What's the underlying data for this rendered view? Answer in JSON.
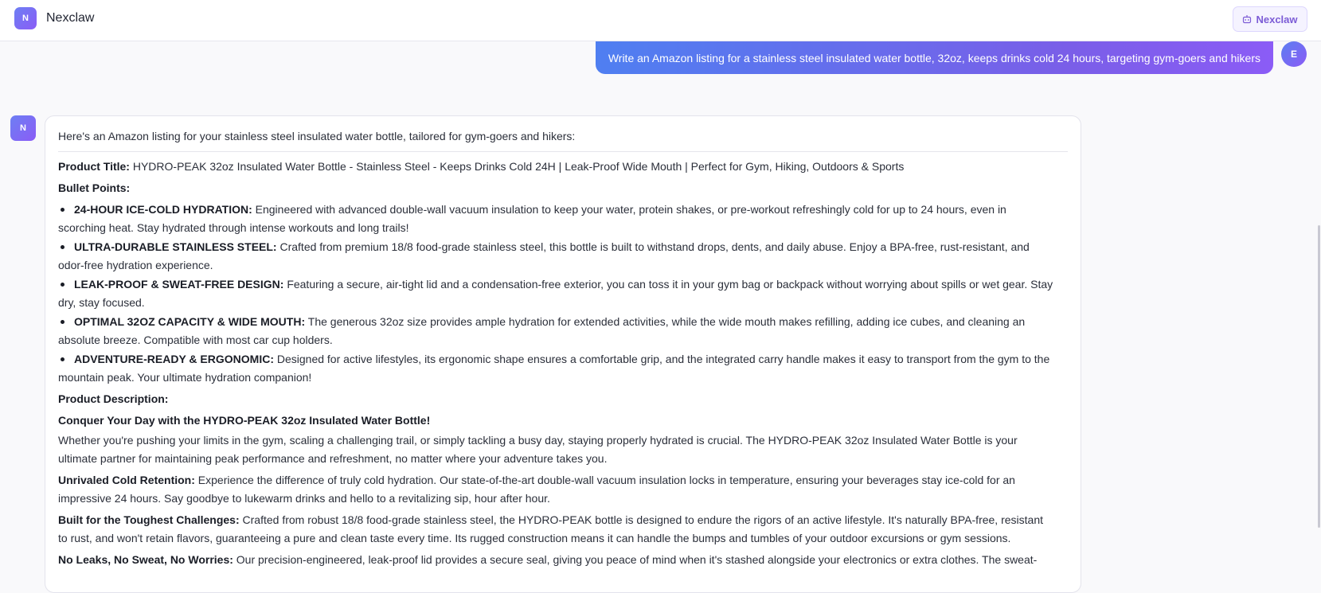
{
  "app": {
    "logo_letter": "N",
    "title": "Nexclaw",
    "header_button_label": "Nexclaw",
    "brand_colors": [
      "#6d7ff3",
      "#8b5cf6"
    ]
  },
  "user_message": {
    "avatar_letter": "E",
    "text": "Write an Amazon listing for a stainless steel insulated water bottle, 32oz, keeps drinks cold 24 hours, targeting gym-goers and hikers"
  },
  "assistant_message": {
    "avatar_letter": "N",
    "intro": "Here's an Amazon listing for your stainless steel insulated water bottle, tailored for gym-goers and hikers:",
    "title_label": "Product Title:",
    "title_text": "HYDRO-PEAK 32oz Insulated Water Bottle - Stainless Steel - Keeps Drinks Cold 24H | Leak-Proof Wide Mouth | Perfect for Gym, Hiking, Outdoors & Sports",
    "bullets_label": "Bullet Points:",
    "bullets": [
      {
        "label": "24-HOUR ICE-COLD HYDRATION:",
        "line1": "Engineered with advanced double-wall vacuum insulation to keep your water, protein shakes, or pre-workout refreshingly cold for up to 24 hours, even in",
        "line2": "scorching heat. Stay hydrated through intense workouts and long trails!"
      },
      {
        "label": "ULTRA-DURABLE STAINLESS STEEL:",
        "line1": "Crafted from premium 18/8 food-grade stainless steel, this bottle is built to withstand drops, dents, and daily abuse. Enjoy a BPA-free, rust-resistant, and",
        "line2": "odor-free hydration experience."
      },
      {
        "label": "LEAK-PROOF & SWEAT-FREE DESIGN:",
        "line1": "Featuring a secure, air-tight lid and a condensation-free exterior, you can toss it in your gym bag or backpack without worrying about spills or wet gear. Stay",
        "line2": "dry, stay focused."
      },
      {
        "label": "OPTIMAL 32OZ CAPACITY & WIDE MOUTH:",
        "line1": "The generous 32oz size provides ample hydration for extended activities, while the wide mouth makes refilling, adding ice cubes, and cleaning an",
        "line2": "absolute breeze. Compatible with most car cup holders."
      },
      {
        "label": "ADVENTURE-READY & ERGONOMIC:",
        "line1": "Designed for active lifestyles, its ergonomic shape ensures a comfortable grip, and the integrated carry handle makes it easy to transport from the gym to the",
        "line2": "mountain peak. Your ultimate hydration companion!"
      }
    ],
    "description_label": "Product Description:",
    "description_heading": "Conquer Your Day with the HYDRO-PEAK 32oz Insulated Water Bottle!",
    "description_paragraphs": [
      {
        "label": "",
        "line1": "Whether you're pushing your limits in the gym, scaling a challenging trail, or simply tackling a busy day, staying properly hydrated is crucial. The HYDRO-PEAK 32oz Insulated Water Bottle is your",
        "line2": "ultimate partner for maintaining peak performance and refreshment, no matter where your adventure takes you."
      },
      {
        "label": "Unrivaled Cold Retention:",
        "line1": "Experience the difference of truly cold hydration. Our state-of-the-art double-wall vacuum insulation locks in temperature, ensuring your beverages stay ice-cold for an",
        "line2": "impressive 24 hours. Say goodbye to lukewarm drinks and hello to a revitalizing sip, hour after hour."
      },
      {
        "label": "Built for the Toughest Challenges:",
        "line1": "Crafted from robust 18/8 food-grade stainless steel, the HYDRO-PEAK bottle is designed to endure the rigors of an active lifestyle. It's naturally BPA-free, resistant",
        "line2": "to rust, and won't retain flavors, guaranteeing a pure and clean taste every time. Its rugged construction means it can handle the bumps and tumbles of your outdoor excursions or gym sessions."
      },
      {
        "label": "No Leaks, No Sweat, No Worries:",
        "line1": "Our precision-engineered, leak-proof lid provides a secure seal, giving you peace of mind when it's stashed alongside your electronics or extra clothes. The sweat-",
        "line2": ""
      }
    ]
  }
}
